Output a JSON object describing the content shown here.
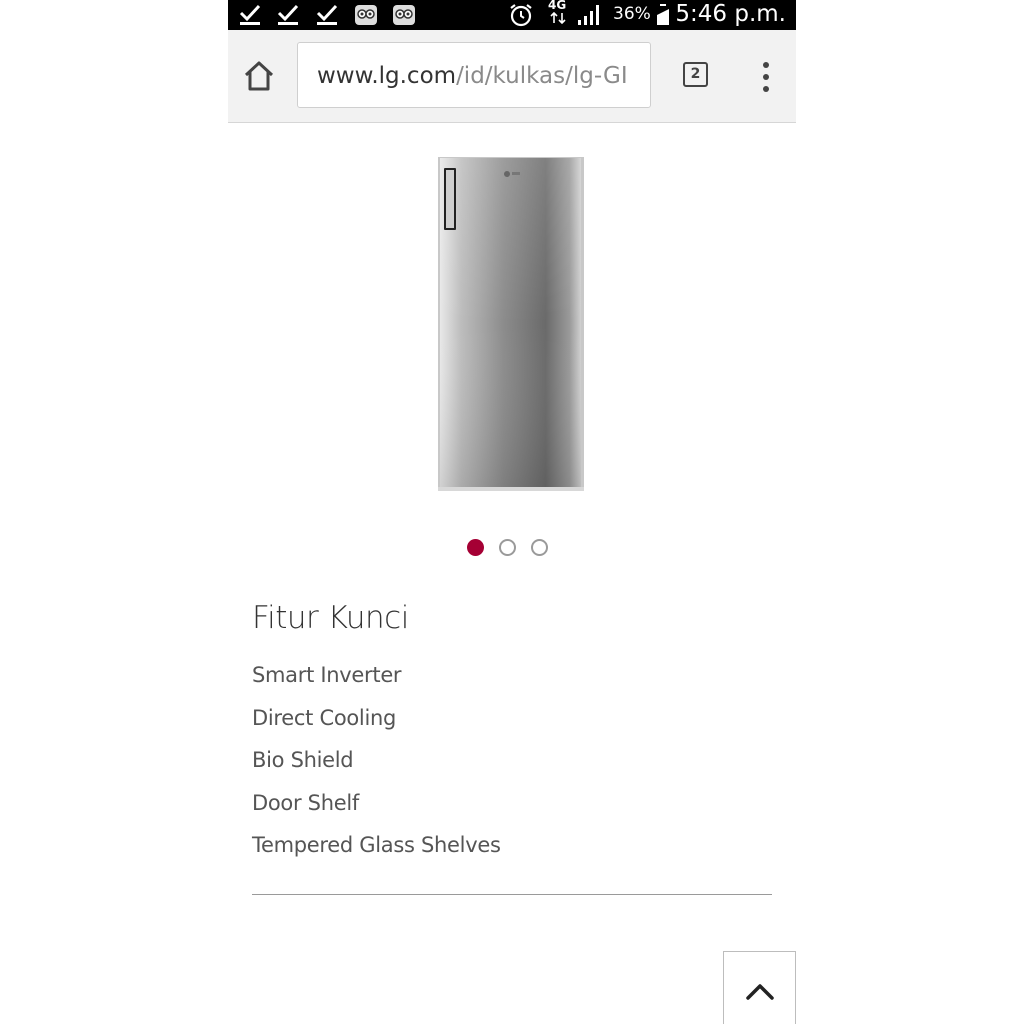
{
  "status_bar": {
    "icons": [
      "checkmark-icon",
      "checkmark-icon",
      "checkmark-icon",
      "owl-app-icon",
      "owl-app-icon",
      "alarm-clock-icon",
      "network-4g-icon",
      "signal-bars-icon",
      "battery-icon"
    ],
    "network_label": "4G",
    "battery_percent": "36%",
    "time": "5:46 p.m."
  },
  "browser": {
    "url_domain": "www.lg.com",
    "url_path": "/id/kulkas/lg-GI",
    "tab_count": "2"
  },
  "carousel": {
    "total": 3,
    "active_index": 0,
    "active_color": "#a50034"
  },
  "features": {
    "title": "Fitur Kunci",
    "items": [
      "Smart Inverter",
      "Direct Cooling",
      "Bio Shield",
      "Door Shelf",
      "Tempered Glass Shelves"
    ]
  },
  "colors": {
    "status_bar_bg": "#000000",
    "toolbar_bg": "#f2f2f2"
  }
}
